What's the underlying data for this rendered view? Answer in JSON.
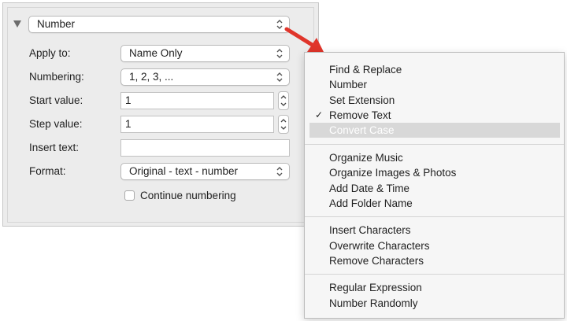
{
  "panel": {
    "type_select_value": "Number",
    "apply_to": {
      "label": "Apply to:",
      "value": "Name Only"
    },
    "numbering": {
      "label": "Numbering:",
      "value": "1, 2, 3, ..."
    },
    "start_value": {
      "label": "Start value:",
      "value": "1"
    },
    "step_value": {
      "label": "Step value:",
      "value": "1"
    },
    "insert_text": {
      "label": "Insert text:",
      "value": ""
    },
    "format": {
      "label": "Format:",
      "value": "Original - text - number"
    },
    "continue_numbering": {
      "label": "Continue numbering",
      "checked": false
    }
  },
  "menu": {
    "group1": [
      "Find & Replace",
      "Number",
      "Set Extension",
      "Remove Text",
      "Convert Case"
    ],
    "checked_item": "Remove Text",
    "highlighted_item": "Convert Case",
    "group2": [
      "Organize Music",
      "Organize Images & Photos",
      "Add Date & Time",
      "Add Folder Name"
    ],
    "group3": [
      "Insert Characters",
      "Overwrite Characters",
      "Remove Characters"
    ],
    "group4": [
      "Regular Expression",
      "Number Randomly"
    ]
  },
  "colors": {
    "arrow": "#e0352b",
    "highlight": "#d8d8d8"
  }
}
